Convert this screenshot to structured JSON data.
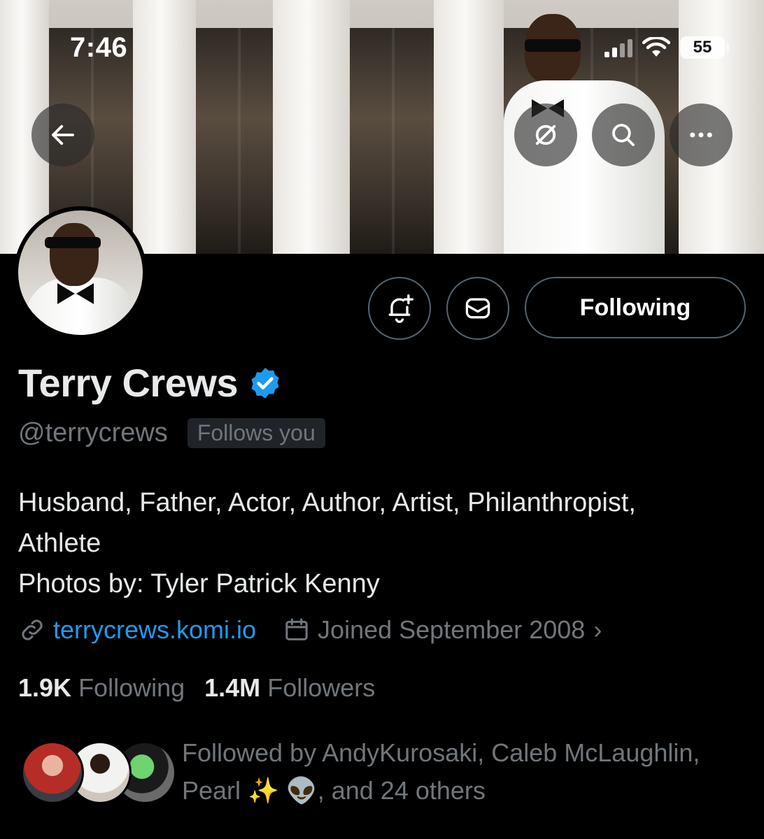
{
  "status_bar": {
    "time": "7:46",
    "battery": "55"
  },
  "profile": {
    "display_name": "Terry Crews",
    "handle": "@terrycrews",
    "follows_you": "Follows you",
    "bio_lines": [
      "Husband, Father, Actor, Author, Artist, Philanthropist,",
      "Athlete",
      "Photos by: Tyler Patrick Kenny"
    ],
    "website": "terrycrews.komi.io",
    "joined": "Joined September 2008",
    "following_count": "1.9K",
    "following_label": "Following",
    "followers_count": "1.4M",
    "followers_label": "Followers",
    "followed_by_line1": "Followed by AndyKurosaki, Caleb McLaughlin,",
    "followed_by_line2_name": "Pearl",
    "followed_by_emoji": "✨ 👽",
    "followed_by_suffix": ", and 24 others"
  },
  "actions": {
    "following_button": "Following"
  },
  "icons": {
    "back": "back-arrow-icon",
    "grok": "grok-icon",
    "search": "search-icon",
    "more": "more-icon",
    "notify": "bell-plus-icon",
    "message": "envelope-icon",
    "verified": "verified-badge-icon",
    "link": "link-icon",
    "calendar": "calendar-icon"
  },
  "colors": {
    "accent": "#1d9bf0",
    "muted": "#71767b",
    "text": "#e7e9ea",
    "background": "#000000"
  }
}
